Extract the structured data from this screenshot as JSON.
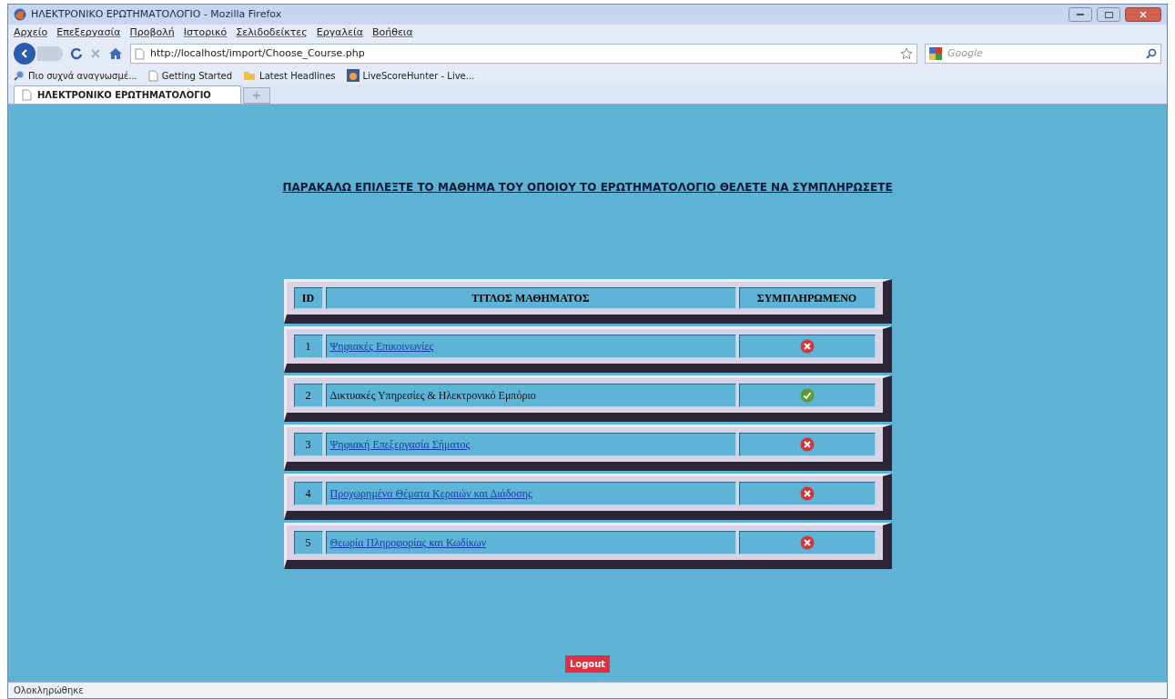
{
  "window": {
    "title": "ΗΛΕΚΤΡΟΝΙΚΟ ΕΡΩΤΗΜΑΤΟΛΟΓΙΟ - Mozilla Firefox"
  },
  "menu": [
    "Αρχείο",
    "Επεξεργασία",
    "Προβολή",
    "Ιστορικό",
    "Σελιδοδείκτες",
    "Εργαλεία",
    "Βοήθεια"
  ],
  "address": {
    "value": "http://localhost/import/Choose_Course.php"
  },
  "search": {
    "placeholder": "Google"
  },
  "bookmarks": [
    {
      "label": "Πιο συχνά αναγνωσμέ...",
      "kind": "search"
    },
    {
      "label": "Getting Started",
      "kind": "page"
    },
    {
      "label": "Latest Headlines",
      "kind": "feed"
    },
    {
      "label": "LiveScoreHunter - Live...",
      "kind": "site"
    }
  ],
  "tabs": [
    {
      "label": "ΗΛΕΚΤΡΟΝΙΚΟ ΕΡΩΤΗΜΑΤΟΛΟΓΙΟ",
      "selected": true
    }
  ],
  "heading": "ΠΑΡΑΚΑΛΩ ΕΠΙΛΕΞΤΕ ΤΟ ΜΑΘΗΜΑ ΤΟΥ ΟΠΟΙΟΥ ΤΟ ΕΡΩΤΗΜΑΤΟΛΟΓΙΟ ΘΕΛΕΤΕ ΝΑ ΣΥΜΠΛΗΡΩΣΕΤΕ",
  "table": {
    "columns": [
      "ID",
      "ΤΙΤΛΟΣ ΜΑΘΗΜΑΤΟΣ",
      "ΣΥΜΠΛΗΡΩΜΕΝΟ"
    ],
    "rows": [
      {
        "id": "1",
        "title": "Ψηφιακές Επικοινωνίες",
        "linked": true,
        "completed": false
      },
      {
        "id": "2",
        "title": "Δικτυακές Υπηρεσίες & Ηλεκτρονικό Εμπόριο",
        "linked": false,
        "completed": true
      },
      {
        "id": "3",
        "title": "Ψηφιακή Επεξεργασία Σήματος",
        "linked": true,
        "completed": false
      },
      {
        "id": "4",
        "title": "Προχωρημένα Θέματα Κεραιών και Διάδοσης",
        "linked": true,
        "completed": false
      },
      {
        "id": "5",
        "title": "Θεωρία Πληροφορίας και Κωδίκων",
        "linked": true,
        "completed": false
      }
    ]
  },
  "logout": "Logout",
  "status_bar": "Ολοκληρώθηκε"
}
